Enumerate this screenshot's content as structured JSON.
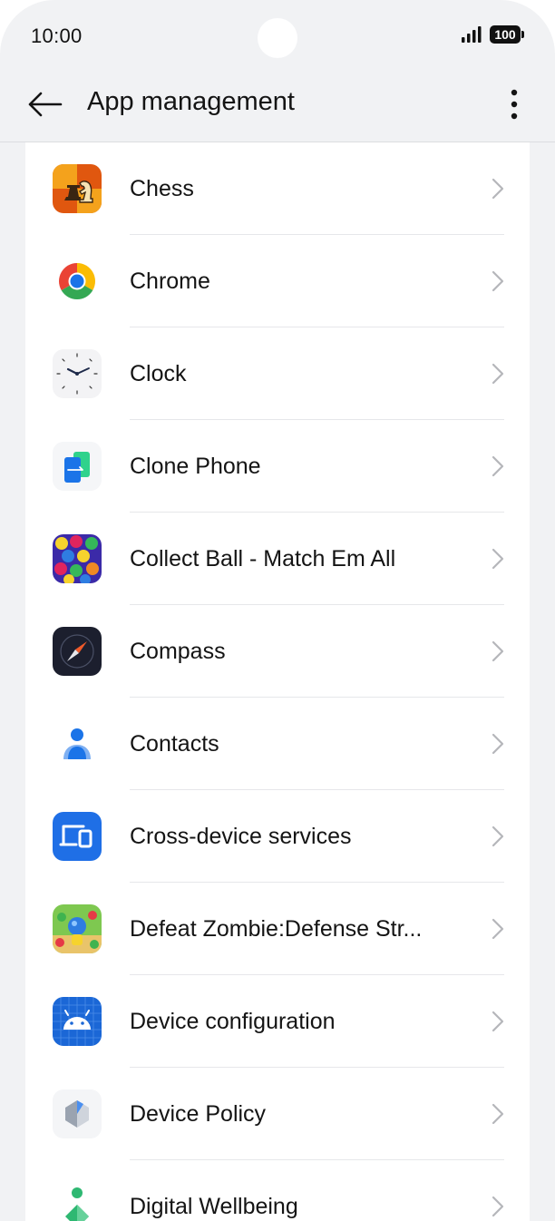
{
  "status_bar": {
    "time": "10:00",
    "battery": "100"
  },
  "app_bar": {
    "title": "App management"
  },
  "apps": [
    {
      "name": "Chess",
      "icon": "chess-icon"
    },
    {
      "name": "Chrome",
      "icon": "chrome-icon"
    },
    {
      "name": "Clock",
      "icon": "clock-icon"
    },
    {
      "name": "Clone Phone",
      "icon": "clone-phone-icon"
    },
    {
      "name": "Collect Ball - Match Em All",
      "icon": "collect-ball-icon"
    },
    {
      "name": "Compass",
      "icon": "compass-icon"
    },
    {
      "name": "Contacts",
      "icon": "contacts-icon"
    },
    {
      "name": "Cross-device services",
      "icon": "cross-device-icon"
    },
    {
      "name": "Defeat Zombie:Defense Str...",
      "icon": "defeat-zombie-icon"
    },
    {
      "name": "Device configuration",
      "icon": "android-icon"
    },
    {
      "name": "Device Policy",
      "icon": "device-policy-icon"
    },
    {
      "name": "Digital Wellbeing",
      "icon": "digital-wellbeing-icon"
    }
  ],
  "colors": {
    "background": "#f1f2f4",
    "card": "#ffffff",
    "text": "#141414",
    "chevron": "#b5b6ba"
  }
}
